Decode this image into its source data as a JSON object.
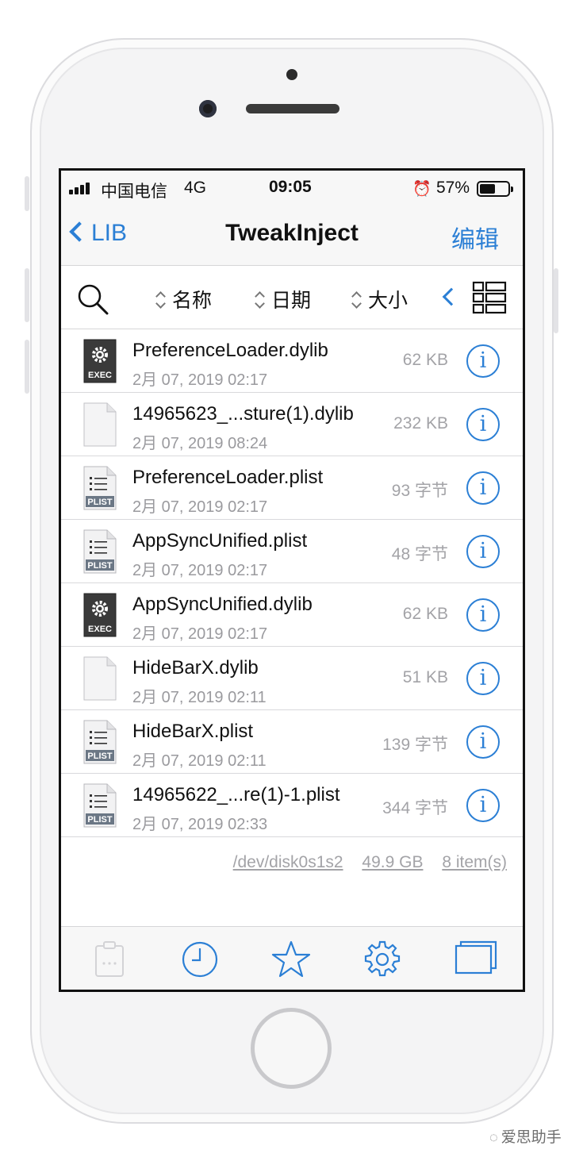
{
  "status_bar": {
    "carrier": "中国电信",
    "network": "4G",
    "time": "09:05",
    "battery_percent": "57%",
    "battery_level": 0.57,
    "alarm_icon": "alarm-clock-icon"
  },
  "nav": {
    "back_label": "LIB",
    "title": "TweakInject",
    "edit_label": "编辑"
  },
  "toolbar": {
    "sort_name": "名称",
    "sort_date": "日期",
    "sort_size": "大小"
  },
  "files": [
    {
      "name": "PreferenceLoader.dylib",
      "date": "2月 07, 2019 02:17",
      "size": "62 KB",
      "icon": "exec",
      "icon_label": "EXEC"
    },
    {
      "name": "14965623_...sture(1).dylib",
      "date": "2月 07, 2019 08:24",
      "size": "232 KB",
      "icon": "blank",
      "icon_label": ""
    },
    {
      "name": "PreferenceLoader.plist",
      "date": "2月 07, 2019 02:17",
      "size": "93 字节",
      "icon": "plist",
      "icon_label": "PLIST"
    },
    {
      "name": "AppSyncUnified.plist",
      "date": "2月 07, 2019 02:17",
      "size": "48 字节",
      "icon": "plist",
      "icon_label": "PLIST"
    },
    {
      "name": "AppSyncUnified.dylib",
      "date": "2月 07, 2019 02:17",
      "size": "62 KB",
      "icon": "exec",
      "icon_label": "EXEC"
    },
    {
      "name": "HideBarX.dylib",
      "date": "2月 07, 2019 02:11",
      "size": "51 KB",
      "icon": "blank",
      "icon_label": ""
    },
    {
      "name": "HideBarX.plist",
      "date": "2月 07, 2019 02:11",
      "size": "139 字节",
      "icon": "plist",
      "icon_label": "PLIST"
    },
    {
      "name": "14965622_...re(1)-1.plist",
      "date": "2月 07, 2019 02:33",
      "size": "344 字节",
      "icon": "plist",
      "icon_label": "PLIST"
    }
  ],
  "info_glyph": "i",
  "footer": {
    "device": "/dev/disk0s1s2",
    "capacity": "49.9 GB",
    "count": "8 item(s)"
  },
  "tabbar": [
    "clipboard-icon",
    "clock-icon",
    "star-icon",
    "gear-icon",
    "windows-icon"
  ],
  "watermark": "爱思助手",
  "colors": {
    "accent": "#2b7fd5"
  }
}
